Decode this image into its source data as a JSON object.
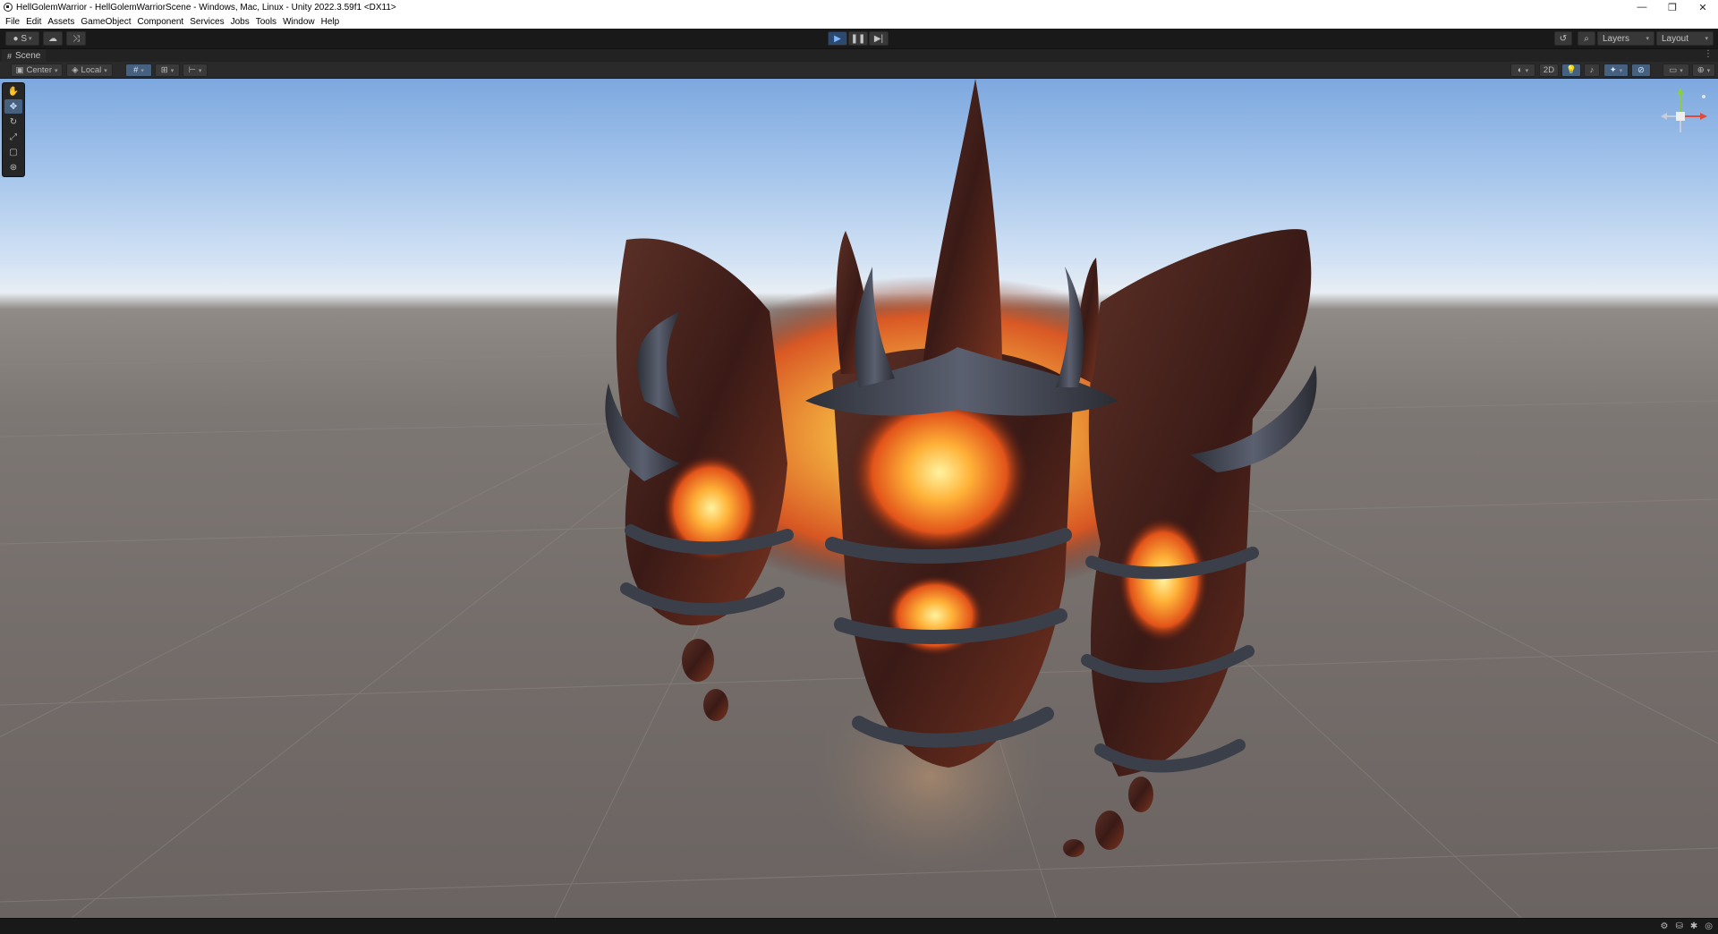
{
  "window": {
    "title": "HellGolemWarrior - HellGolemWarriorScene - Windows, Mac, Linux - Unity 2022.3.59f1 <DX11>",
    "controls": {
      "minimize": "—",
      "maximize": "❐",
      "close": "✕"
    }
  },
  "menu": [
    "File",
    "Edit",
    "Assets",
    "GameObject",
    "Component",
    "Services",
    "Jobs",
    "Tools",
    "Window",
    "Help"
  ],
  "toolbar": {
    "account_label": "S",
    "layers_label": "Layers",
    "layout_label": "Layout",
    "play_state": "stopped"
  },
  "scene_tab": {
    "label": "Scene",
    "icon": "#"
  },
  "scene_toolbar": {
    "pivot_label": "Center",
    "space_label": "Local",
    "mode_2d_label": "2D"
  },
  "tools": [
    "view-hand",
    "move",
    "rotate",
    "scale",
    "rect",
    "transform"
  ],
  "active_tool": "move",
  "gizmo": {
    "x_color": "#e04a3a",
    "y_color": "#8ccf3c",
    "z_color": "#3a7bd5"
  },
  "colors": {
    "sky_top": "#7da8df",
    "horizon": "#e8eef4",
    "ground": "#736c69",
    "lava": "#ff8a1e",
    "rock": "#3a3c44"
  }
}
